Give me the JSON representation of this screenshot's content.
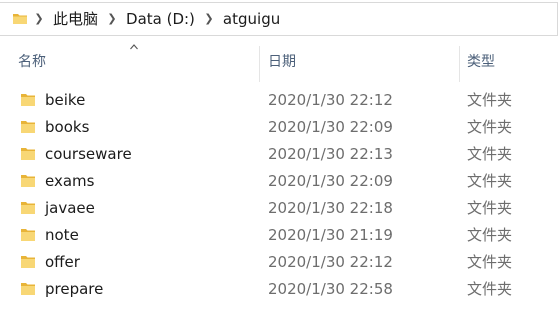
{
  "address_bar": {
    "icon": "folder-icon",
    "separator_icon": "chevron-right-icon",
    "crumbs": [
      "此电脑",
      "Data (D:)",
      "atguigu"
    ]
  },
  "headers": {
    "name": "名称",
    "date": "日期",
    "type": "类型",
    "sort_indicator": "sort-ascending-icon"
  },
  "files": [
    {
      "name": "beike",
      "date": "2020/1/30 22:12",
      "type": "文件夹",
      "icon": "folder-icon"
    },
    {
      "name": "books",
      "date": "2020/1/30 22:09",
      "type": "文件夹",
      "icon": "folder-icon"
    },
    {
      "name": "courseware",
      "date": "2020/1/30 22:13",
      "type": "文件夹",
      "icon": "folder-icon"
    },
    {
      "name": "exams",
      "date": "2020/1/30 22:09",
      "type": "文件夹",
      "icon": "folder-icon"
    },
    {
      "name": "javaee",
      "date": "2020/1/30 22:18",
      "type": "文件夹",
      "icon": "folder-icon"
    },
    {
      "name": "note",
      "date": "2020/1/30 21:19",
      "type": "文件夹",
      "icon": "folder-icon"
    },
    {
      "name": "offer",
      "date": "2020/1/30 22:12",
      "type": "文件夹",
      "icon": "folder-icon"
    },
    {
      "name": "prepare",
      "date": "2020/1/30 22:58",
      "type": "文件夹",
      "icon": "folder-icon"
    }
  ],
  "colors": {
    "folder_fill": "#f8d775",
    "folder_back": "#e8b438",
    "header_text": "#4c607a",
    "secondary_text": "#6d6d6d"
  }
}
